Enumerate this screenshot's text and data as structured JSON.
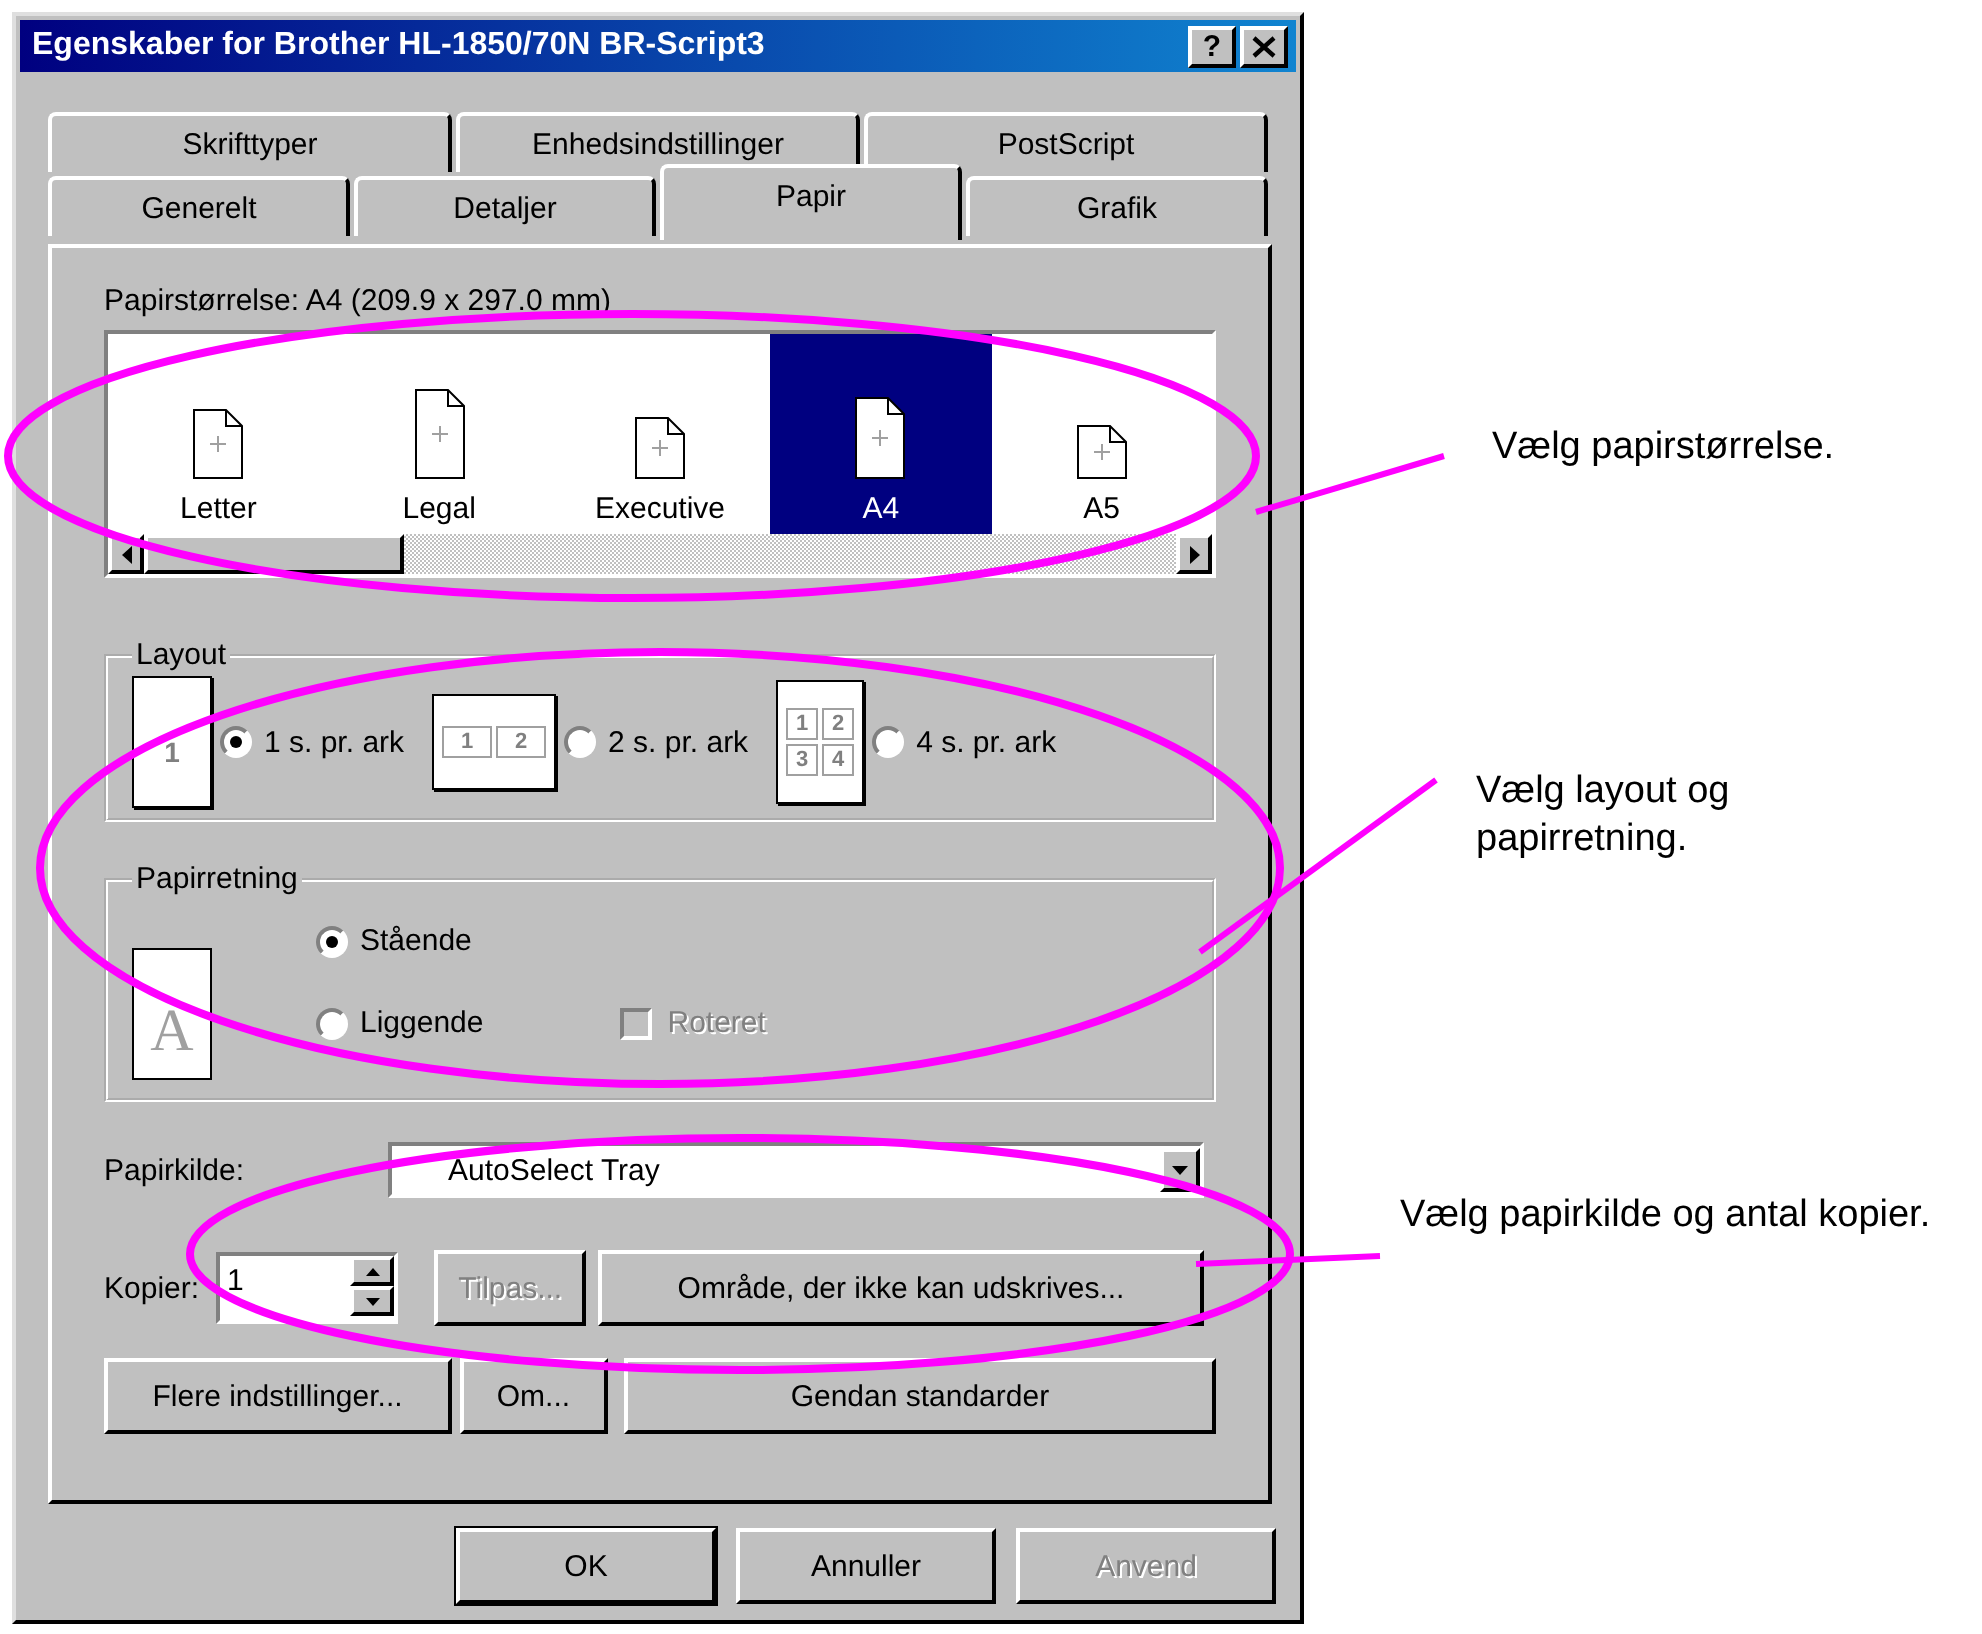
{
  "window": {
    "title": "Egenskaber for Brother HL-1850/70N BR-Script3",
    "help": "?"
  },
  "tabs": [
    [
      {
        "label": "Skrifttyper",
        "selected": false
      },
      {
        "label": "Enhedsindstillinger",
        "selected": false
      },
      {
        "label": "PostScript",
        "selected": false
      }
    ],
    [
      {
        "label": "Generelt",
        "selected": false
      },
      {
        "label": "Detaljer",
        "selected": false
      },
      {
        "label": "Papir",
        "selected": true
      },
      {
        "label": "Grafik",
        "selected": false
      }
    ]
  ],
  "paper_size": {
    "label": "Papirstørrelse:",
    "value": "A4 (209.9 x 297.0 mm)",
    "items": [
      {
        "label": "Letter",
        "selected": false
      },
      {
        "label": "Legal",
        "selected": false
      },
      {
        "label": "Executive",
        "selected": false
      },
      {
        "label": "A4",
        "selected": true
      },
      {
        "label": "A5",
        "selected": false
      }
    ]
  },
  "layout": {
    "title": "Layout",
    "options": [
      {
        "label": "1 s. pr. ark",
        "selected": true,
        "pages": [
          "1"
        ]
      },
      {
        "label": "2 s. pr. ark",
        "selected": false,
        "pages": [
          "1",
          "2"
        ]
      },
      {
        "label": "4 s. pr. ark",
        "selected": false,
        "pages": [
          "1",
          "2",
          "3",
          "4"
        ]
      }
    ]
  },
  "orientation": {
    "title": "Papirretning",
    "icon_letter": "A",
    "options": [
      {
        "label": "Stående",
        "selected": true
      },
      {
        "label": "Liggende",
        "selected": false
      }
    ],
    "rotate": {
      "label": "Roteret",
      "checked": false,
      "disabled": true
    }
  },
  "paper_source": {
    "label": "Papirkilde:",
    "value": "AutoSelect Tray"
  },
  "copies": {
    "label": "Kopier:",
    "value": "1"
  },
  "button_rows": [
    [
      {
        "label": "Tilpas...",
        "disabled": true
      },
      {
        "label": "Område, der ikke kan udskrives...",
        "disabled": false
      }
    ],
    [
      {
        "label": "Flere indstillinger...",
        "disabled": false
      },
      {
        "label": "Om...",
        "disabled": false
      },
      {
        "label": "Gendan standarder",
        "disabled": false
      }
    ]
  ],
  "footer_buttons": [
    {
      "label": "OK",
      "disabled": false,
      "default": true
    },
    {
      "label": "Annuller",
      "disabled": false,
      "default": false
    },
    {
      "label": "Anvend",
      "disabled": true,
      "default": false
    }
  ],
  "annotations": [
    {
      "text": "Vælg papirstørrelse."
    },
    {
      "text": "Vælg layout og papirretning."
    },
    {
      "text": "Vælg papirkilde og antal kopier."
    }
  ]
}
